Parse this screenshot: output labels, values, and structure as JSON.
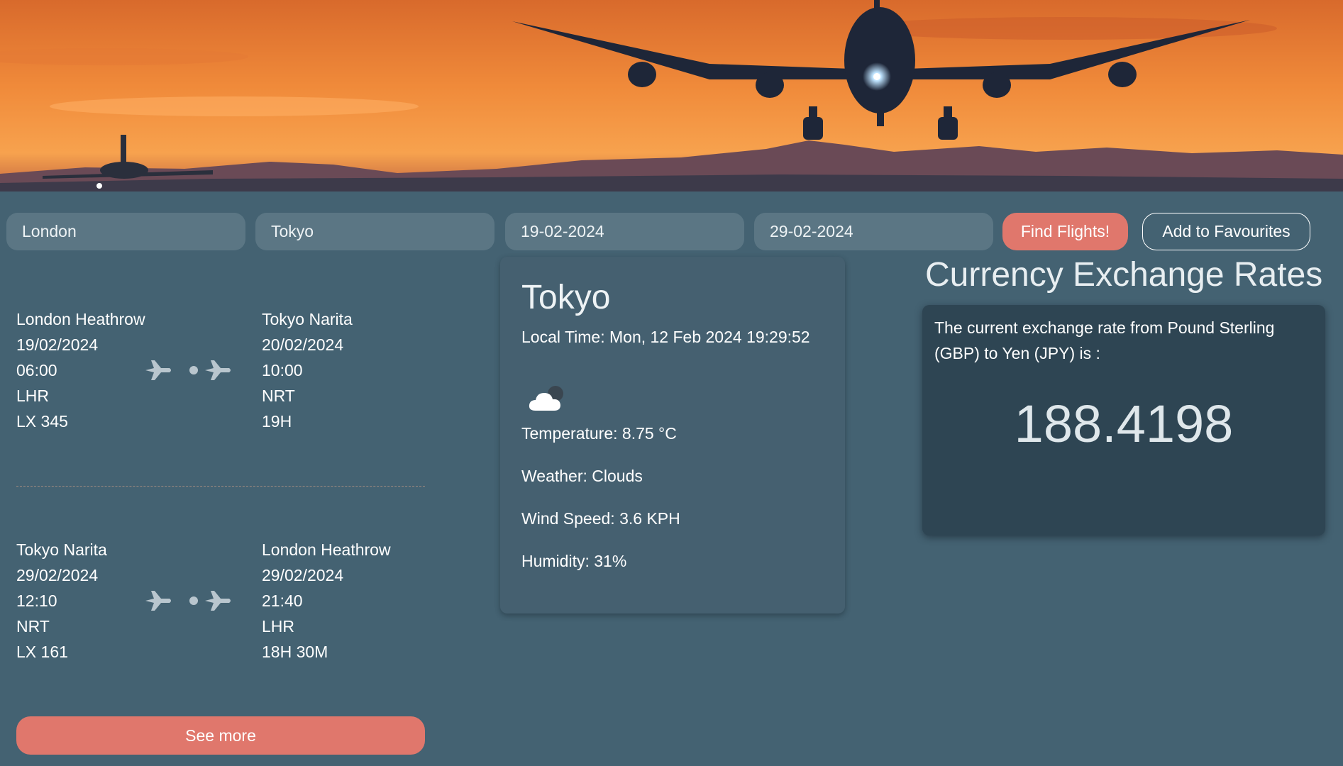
{
  "search": {
    "origin_value": "London",
    "destination_value": "Tokyo",
    "depart_date_value": "19-02-2024",
    "return_date_value": "29-02-2024",
    "find_label": "Find Flights!",
    "favourites_label": "Add to Favourites"
  },
  "flights": [
    {
      "departure": {
        "airport": "London Heathrow",
        "date": "19/02/2024",
        "time": "06:00",
        "code": "LHR",
        "flight_no": "LX 345"
      },
      "arrival": {
        "airport": "Tokyo Narita",
        "date": "20/02/2024",
        "time": "10:00",
        "code": "NRT",
        "duration": "19H"
      }
    },
    {
      "departure": {
        "airport": "Tokyo Narita",
        "date": "29/02/2024",
        "time": "12:10",
        "code": "NRT",
        "flight_no": "LX 161"
      },
      "arrival": {
        "airport": "London Heathrow",
        "date": "29/02/2024",
        "time": "21:40",
        "code": "LHR",
        "duration": "18H 30M"
      }
    }
  ],
  "see_more_label": "See more",
  "weather": {
    "city": "Tokyo",
    "local_time": "Local Time: Mon, 12 Feb 2024 19:29:52",
    "icon": "cloud-icon",
    "temperature": "Temperature: 8.75 °C",
    "conditions": "Weather: Clouds",
    "wind": "Wind Speed: 3.6 KPH",
    "humidity": "Humidity: 31%"
  },
  "currency": {
    "title": "Currency Exchange Rates",
    "description": "The current exchange rate from Pound Sterling (GBP) to Yen (JPY) is :",
    "rate": "188.4198"
  },
  "colors": {
    "background": "#446272",
    "accent": "#e0776c",
    "input": "#5b7684",
    "card_dark": "#2e4553"
  }
}
